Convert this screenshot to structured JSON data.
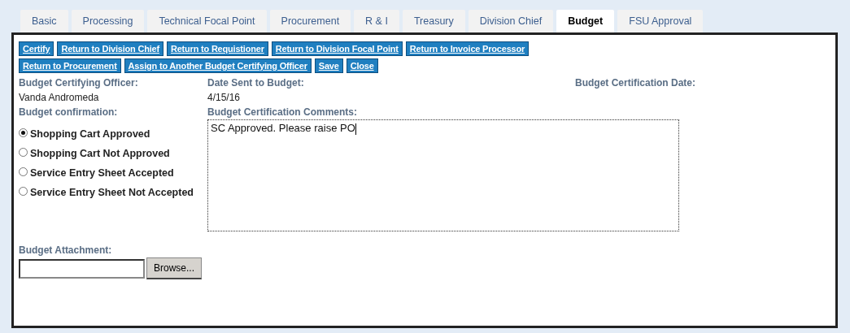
{
  "tabs": [
    {
      "label": "Basic",
      "selected": false
    },
    {
      "label": "Processing",
      "selected": false
    },
    {
      "label": "Technical Focal Point",
      "selected": false
    },
    {
      "label": "Procurement",
      "selected": false
    },
    {
      "label": "R & I",
      "selected": false
    },
    {
      "label": "Treasury",
      "selected": false
    },
    {
      "label": "Division Chief",
      "selected": false
    },
    {
      "label": "Budget",
      "selected": true
    },
    {
      "label": "FSU Approval",
      "selected": false
    }
  ],
  "action_rows": [
    [
      "Certify",
      "Return to Division Chief",
      "Return to Requistioner",
      "Return to Division Focal Point",
      "Return to Invoice Processor"
    ],
    [
      "Return to Procurement",
      "Assign to Another Budget Certifying Officer",
      "Save",
      "Close"
    ]
  ],
  "officer": {
    "label": "Budget Certifying Officer:",
    "value": "Vanda Andromeda"
  },
  "date_sent": {
    "label": "Date Sent to Budget:",
    "value": "4/15/16"
  },
  "certification_date": {
    "label": "Budget Certification Date:"
  },
  "confirmation": {
    "label": "Budget confirmation:",
    "options": [
      {
        "label": "Shopping Cart Approved",
        "selected": true
      },
      {
        "label": "Shopping Cart Not Approved",
        "selected": false
      },
      {
        "label": "Service Entry Sheet Accepted",
        "selected": false
      },
      {
        "label": "Service Entry Sheet Not Accepted",
        "selected": false
      }
    ]
  },
  "comments": {
    "label": "Budget Certification Comments:",
    "value": "SC Approved. Please raise PO"
  },
  "attachment": {
    "label": "Budget Attachment:",
    "button": "Browse..."
  }
}
